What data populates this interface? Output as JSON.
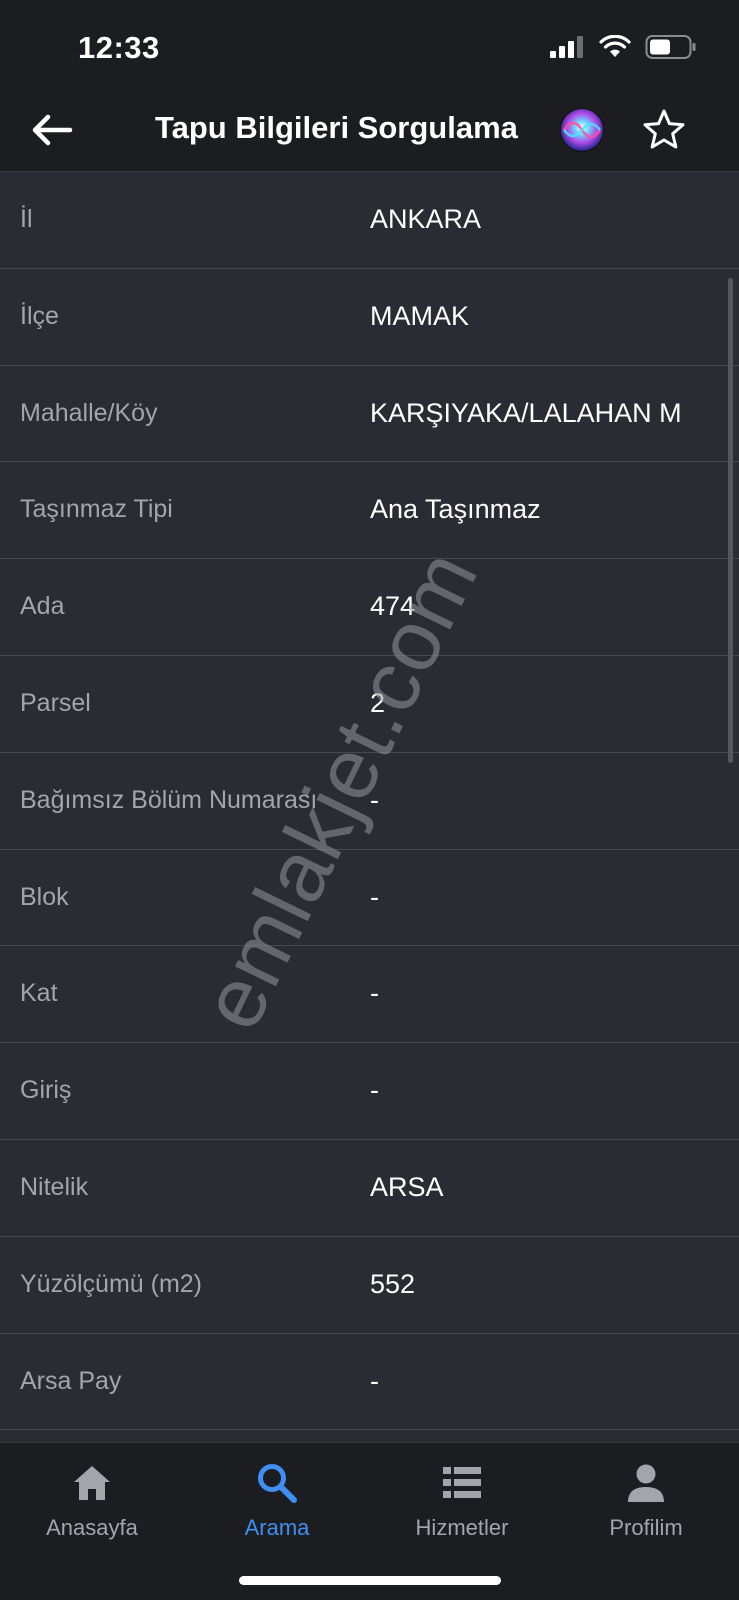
{
  "status": {
    "time": "12:33"
  },
  "nav": {
    "title": "Tapu Bilgileri Sorgulama"
  },
  "rows": [
    {
      "label": "İl",
      "value": "ANKARA"
    },
    {
      "label": "İlçe",
      "value": "MAMAK"
    },
    {
      "label": "Mahalle/Köy",
      "value": "KARŞIYAKA/LALAHAN M"
    },
    {
      "label": "Taşınmaz Tipi",
      "value": "Ana Taşınmaz"
    },
    {
      "label": "Ada",
      "value": "474"
    },
    {
      "label": "Parsel",
      "value": "2"
    },
    {
      "label": "Bağımsız Bölüm Numarası",
      "value": "-"
    },
    {
      "label": "Blok",
      "value": "-"
    },
    {
      "label": "Kat",
      "value": "-"
    },
    {
      "label": "Giriş",
      "value": "-"
    },
    {
      "label": "Nitelik",
      "value": "ARSA"
    },
    {
      "label": "Yüzölçümü (m2)",
      "value": "552"
    },
    {
      "label": "Arsa Pay",
      "value": "-"
    }
  ],
  "watermark": "emlakjet.com",
  "tabs": [
    {
      "label": "Anasayfa",
      "icon": "home-icon"
    },
    {
      "label": "Arama",
      "icon": "search-icon"
    },
    {
      "label": "Hizmetler",
      "icon": "list-icon"
    },
    {
      "label": "Profilim",
      "icon": "person-icon"
    }
  ],
  "colors": {
    "accent": "#3f8ff0",
    "background": "#1c1d21",
    "list_background": "#2a2c33"
  }
}
